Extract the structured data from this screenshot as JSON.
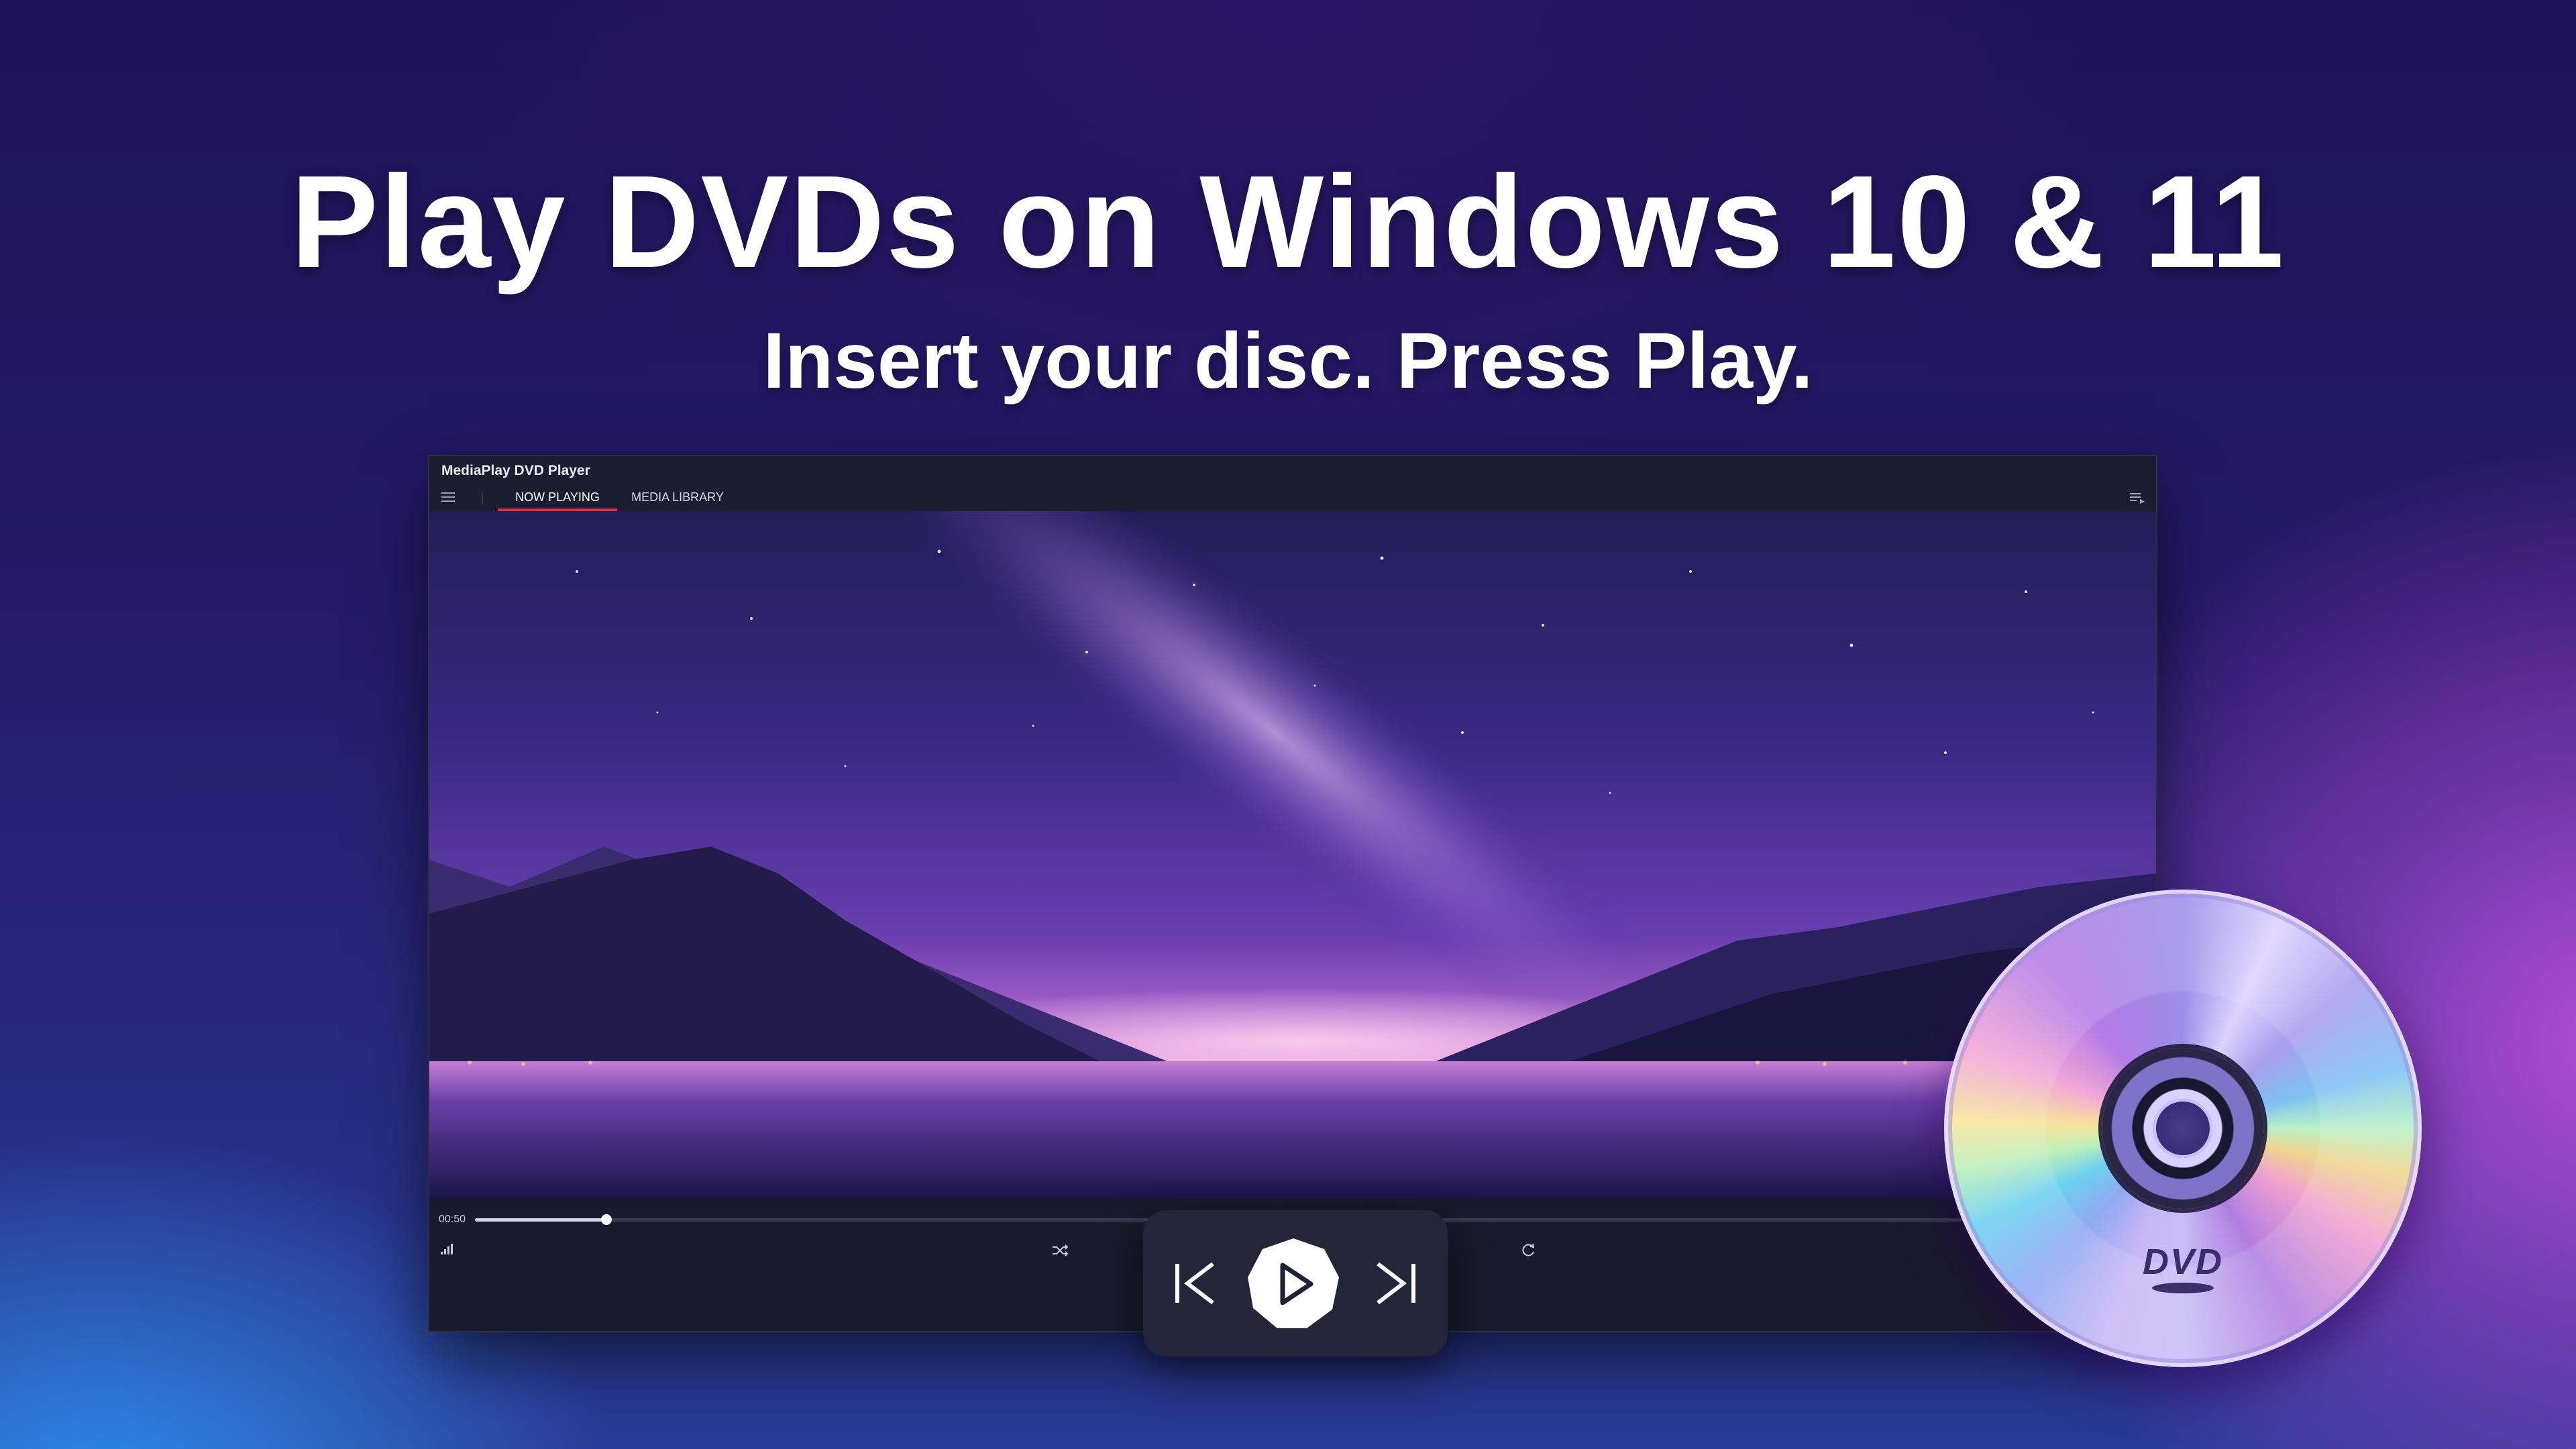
{
  "headline": "Play DVDs on Windows 10 & 11",
  "subline": "Insert your disc. Press Play.",
  "window": {
    "title": "MediaPlay DVD Player",
    "tabs": [
      {
        "label": "NOW PLAYING",
        "active": true
      },
      {
        "label": "MEDIA LIBRARY",
        "active": false
      }
    ]
  },
  "player": {
    "time_elapsed": "00:50",
    "progress": 0.08
  },
  "disc": {
    "logo": "DVD"
  },
  "icons": {
    "menu": "hamburger-menu-icon",
    "playlist": "playlist-icon",
    "volume": "volume-icon",
    "shuffle": "shuffle-icon",
    "repeat": "repeat-icon",
    "previous": "skip-previous-icon",
    "play": "play-icon",
    "next": "skip-next-icon"
  },
  "colors": {
    "accent": "#d8324a",
    "window_bg": "#1a1b2e",
    "text": "#ffffff"
  }
}
